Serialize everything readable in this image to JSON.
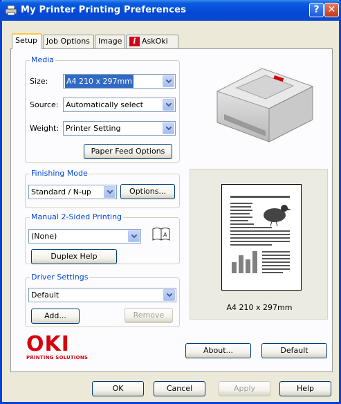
{
  "window": {
    "title": "My Printer Printing Preferences",
    "help_glyph": "?",
    "close_glyph": "✕"
  },
  "tabs": [
    {
      "label": "Setup",
      "active": true
    },
    {
      "label": "Job Options"
    },
    {
      "label": "Image"
    },
    {
      "label": "AskOki",
      "icon": "info-book-icon"
    }
  ],
  "media": {
    "group_label": "Media",
    "size_label": "Size:",
    "size_value": "A4 210 x 297mm",
    "source_label": "Source:",
    "source_value": "Automatically select",
    "weight_label": "Weight:",
    "weight_value": "Printer Setting",
    "paper_feed_button": "Paper Feed Options"
  },
  "finishing": {
    "group_label": "Finishing Mode",
    "value": "Standard / N-up",
    "options_button": "Options..."
  },
  "manual_duplex": {
    "group_label": "Manual 2-Sided Printing",
    "value": "(None)",
    "duplex_help_button": "Duplex Help"
  },
  "driver": {
    "group_label": "Driver Settings",
    "value": "Default",
    "add_button": "Add...",
    "remove_button": "Remove"
  },
  "preview": {
    "caption": "A4 210 x 297mm"
  },
  "brand": {
    "name": "OKI",
    "tagline": "PRINTING SOLUTIONS",
    "color": "#d7000f"
  },
  "panel_buttons": {
    "about": "About...",
    "default": "Default"
  },
  "footer": {
    "ok": "OK",
    "cancel": "Cancel",
    "apply": "Apply",
    "help": "Help"
  },
  "colors": {
    "title_bar": "#0548d6",
    "group_label": "#0046d5",
    "selection": "#316ac5"
  }
}
